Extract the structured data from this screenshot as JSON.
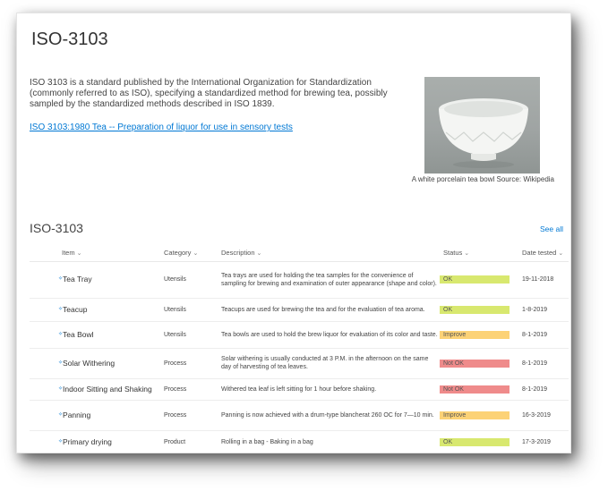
{
  "page": {
    "title": "ISO-3103",
    "intro": "ISO 3103 is a standard published by the International Organization for Standardization (commonly referred to as ISO), specifying a standardized method for brewing tea, possibly sampled by the standardized methods described in ISO 1839.",
    "link_text": "ISO 3103:1980 Tea -- Preparation of liquor for use in sensory tests",
    "image_caption": "A white porcelain tea bowl Source: Wikipedia"
  },
  "list": {
    "title": "ISO-3103",
    "see_all": "See all",
    "columns": {
      "item": "Item",
      "category": "Category",
      "description": "Description",
      "status": "Status",
      "date": "Date tested"
    },
    "rows": [
      {
        "item": "Tea Tray",
        "category": "Utensils",
        "description": "Tea trays are used for holding the tea samples for the convenience of sampling for brewing and examination of outer appearance (shape and color).",
        "status": "OK",
        "date": "19-11-2018"
      },
      {
        "item": "Teacup",
        "category": "Utensils",
        "description": "Teacups are used for brewing the tea and for the evaluation of tea aroma.",
        "status": "OK",
        "date": "1-8-2019"
      },
      {
        "item": "Tea Bowl",
        "category": "Utensils",
        "description": "Tea bowls are used to hold the brew liquor for evaluation of its color and taste.",
        "status": "Improve",
        "date": "8-1-2019"
      },
      {
        "item": "Solar Withering",
        "category": "Process",
        "description": "Solar withering is usually conducted at 3 P.M. in the afternoon on the same day of harvesting of tea leaves.",
        "status": "Not OK",
        "date": "8-1-2019"
      },
      {
        "item": "Indoor Sitting and Shaking",
        "category": "Process",
        "description": "Withered tea leaf is left sitting for 1 hour before shaking.",
        "status": "Not OK",
        "date": "8-1-2019"
      },
      {
        "item": "Panning",
        "category": "Process",
        "description": "Panning is now achieved with a drum-type blancherat 260 OC for 7—10 min.",
        "status": "Improve",
        "date": "16-3-2019"
      },
      {
        "item": "Primary drying",
        "category": "Product",
        "description": "Rolling in a bag - Baking in a bag",
        "status": "OK",
        "date": "17-3-2019"
      }
    ]
  },
  "colors": {
    "ok": "#d8e86f",
    "improve": "#fcd276",
    "not_ok": "#ef8b8b",
    "link": "#0078d4"
  },
  "icons": {
    "column_sort": "chevron-down-icon",
    "new_item": "new-item-icon"
  }
}
